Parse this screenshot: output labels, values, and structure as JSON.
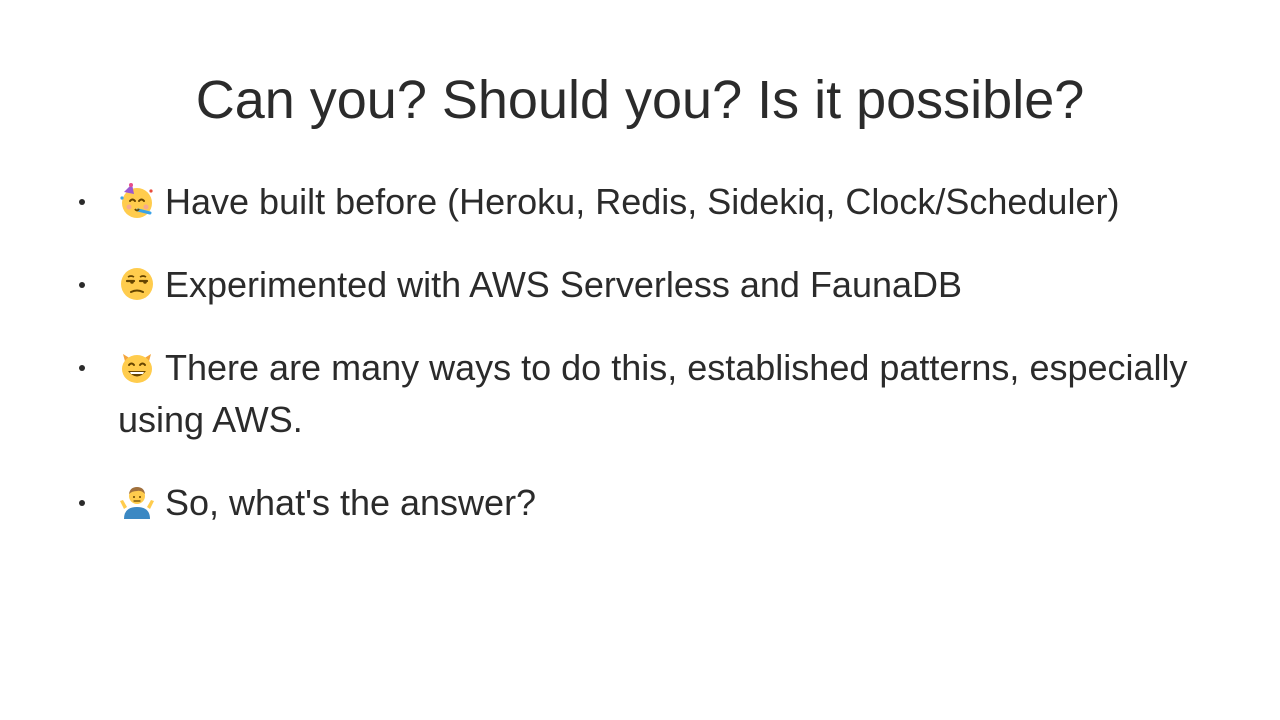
{
  "slide": {
    "title": "Can you? Should you? Is it possible?",
    "bullets": [
      {
        "icon": "partying-face-icon",
        "text": "Have built before (Heroku, Redis, Sidekiq, Clock/Scheduler)"
      },
      {
        "icon": "unamused-face-icon",
        "text": "Experimented with AWS Serverless and FaunaDB"
      },
      {
        "icon": "grinning-cat-icon",
        "text": "There are many ways to do this, established patterns, especially using AWS."
      },
      {
        "icon": "person-shrugging-icon",
        "text": "So, what's the answer?"
      }
    ]
  }
}
